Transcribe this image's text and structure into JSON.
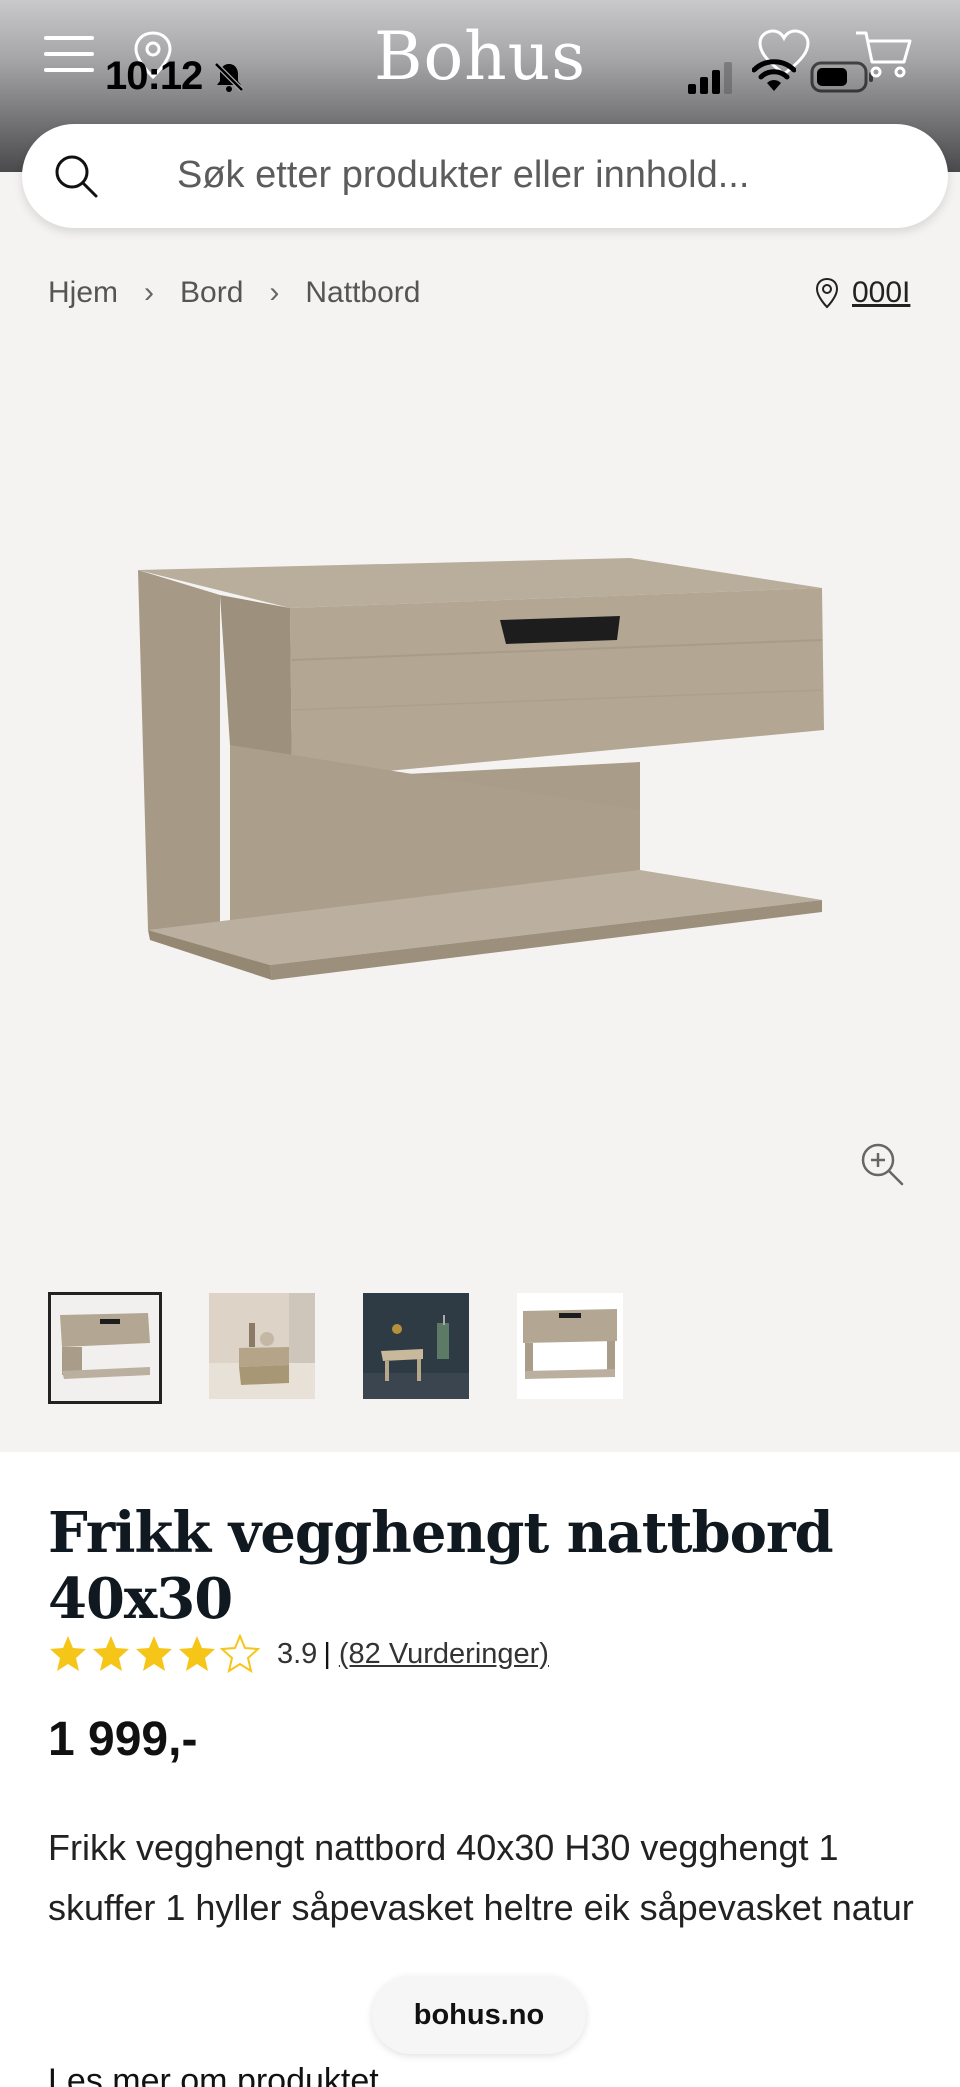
{
  "status_bar": {
    "time": "10:12",
    "icons": [
      "bell-muted-icon",
      "signal-icon",
      "wifi-icon",
      "battery-icon"
    ]
  },
  "header": {
    "logo": "Bohus",
    "icons": [
      "menu-icon",
      "location-pin-icon",
      "heart-icon",
      "cart-icon"
    ]
  },
  "search": {
    "placeholder": "Søk etter produkter eller innhold..."
  },
  "breadcrumb": {
    "items": [
      "Hjem",
      "Bord",
      "Nattbord"
    ],
    "store_label": "000I"
  },
  "gallery": {
    "thumbnail_count": 4,
    "selected_index": 0
  },
  "product": {
    "title": "Frikk vegghengt nattbord 40x30",
    "rating_value": "3.9",
    "rating_stars": 3.9,
    "rating_divider": "|",
    "rating_count": "(82 Vurderinger)",
    "price": "1 999,-",
    "description": "Frikk vegghengt nattbord 40x30 H30 vegghengt 1 skuffer 1 hyller såpevasket heltre eik såpevasket natur",
    "read_more": "Les mer om produktet"
  },
  "browser": {
    "domain": "bohus.no"
  },
  "colors": {
    "star": "#f5c518",
    "header_top": "#c9c9cb",
    "gallery_bg": "#f5f3f2",
    "wood": "#b7ab98"
  }
}
